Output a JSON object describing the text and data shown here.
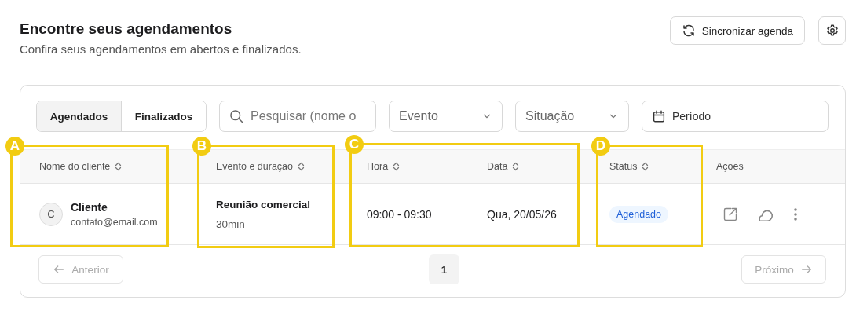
{
  "header": {
    "title": "Encontre seus agendamentos",
    "subtitle": "Confira seus agendamentos em abertos e finalizados.",
    "sync_button": "Sincronizar agenda"
  },
  "tabs": [
    {
      "label": "Agendados",
      "selected": true
    },
    {
      "label": "Finalizados",
      "selected": false
    }
  ],
  "search": {
    "placeholder": "Pesquisar (nome o"
  },
  "filters": [
    {
      "label": "Evento",
      "kind": "dropdown"
    },
    {
      "label": "Situação",
      "kind": "dropdown"
    },
    {
      "label": "Período",
      "kind": "date"
    }
  ],
  "table": {
    "columns": [
      {
        "label": "Nome do cliente",
        "sortable": true
      },
      {
        "label": "Evento e duração",
        "sortable": true
      },
      {
        "label": "Hora",
        "sortable": true
      },
      {
        "label": "Data",
        "sortable": true
      },
      {
        "label": "Status",
        "sortable": true
      },
      {
        "label": "Ações",
        "sortable": false
      }
    ],
    "rows": [
      {
        "avatar": "C",
        "name": "Cliente",
        "email": "contato@email.com",
        "event": "Reunião comercial",
        "duration": "30min",
        "time": "09:00 - 09:30",
        "date": "Qua, 20/05/26",
        "status": "Agendado"
      }
    ]
  },
  "pagination": {
    "previous": {
      "label": "Anterior",
      "disabled": true
    },
    "pages": [
      {
        "label": "1",
        "selected": true
      }
    ],
    "next": {
      "label": "Próximo",
      "disabled": true
    }
  },
  "annotations": [
    {
      "label": "A"
    },
    {
      "label": "B"
    },
    {
      "label": "C"
    },
    {
      "label": "D"
    }
  ]
}
